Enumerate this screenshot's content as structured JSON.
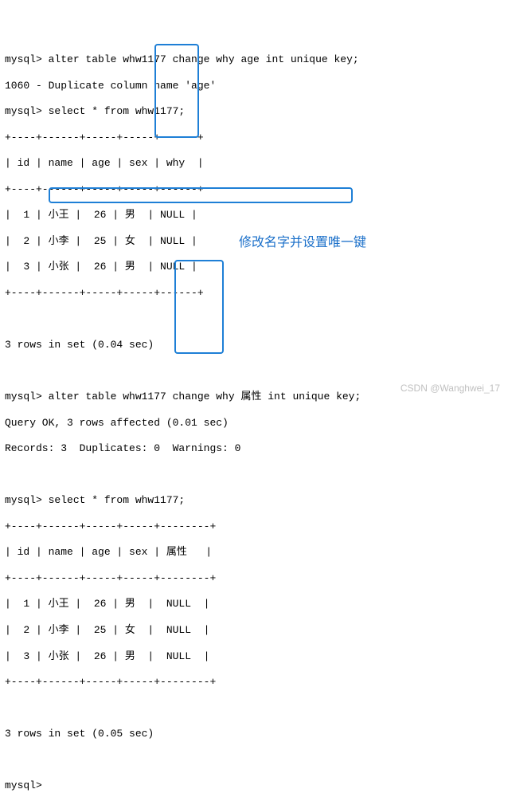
{
  "cmd1_prompt": "mysql> ",
  "cmd1": "alter table whw1177 change why age int unique key;",
  "err": "1060 - Duplicate column name 'age'",
  "cmd2_prompt": "mysql> ",
  "cmd2": "select * from whw1177;",
  "t1_border_a": "+----+------+-----+-----+------+",
  "t1_head": "| id | name | age | sex | why  |",
  "t1_border_b": "+----+------+-----+-----+------+",
  "t1_r1": "|  1 | 小王 |  26 | 男  | NULL |",
  "t1_r2": "|  2 | 小李 |  25 | 女  | NULL |",
  "t1_r3": "|  3 | 小张 |  26 | 男  | NULL |",
  "t1_border_c": "+----+------+-----+-----+------+",
  "t1_status": "3 rows in set (0.04 sec)",
  "cmd3_prompt": "mysql> ",
  "cmd3": "alter table whw1177 change why 属性 int unique key;",
  "ok": "Query OK, 3 rows affected (0.01 sec)",
  "records": "Records: 3  Duplicates: 0  Warnings: 0",
  "cmd4_prompt": "mysql> ",
  "cmd4": "select * from whw1177;",
  "t2_border_a": "+----+------+-----+-----+--------+",
  "t2_head": "| id | name | age | sex | 属性   |",
  "t2_border_b": "+----+------+-----+-----+--------+",
  "t2_r1": "|  1 | 小王 |  26 | 男  |  NULL  |",
  "t2_r2": "|  2 | 小李 |  25 | 女  |  NULL  |",
  "t2_r3": "|  3 | 小张 |  26 | 男  |  NULL  |",
  "t2_border_c": "+----+------+-----+-----+--------+",
  "t2_status": "3 rows in set (0.05 sec)",
  "cmd5_prompt": "mysql> ",
  "annotation": "修改名字并设置唯一键",
  "watermark": "CSDN @Wanghwei_17"
}
